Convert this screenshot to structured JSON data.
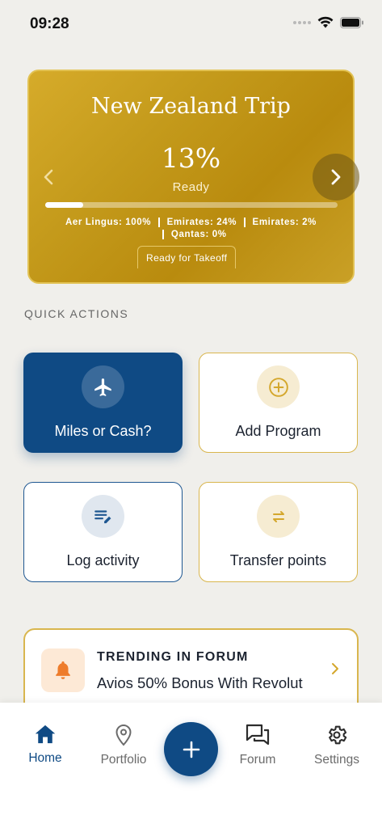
{
  "status_bar": {
    "time": "09:28"
  },
  "trip_card": {
    "title": "New Zealand Trip",
    "percent": "13%",
    "status": "Ready",
    "progress": 0.13,
    "programs": [
      "Aer Lingus: 100%",
      "Emirates: 24%",
      "Emirates: 2%",
      "Qantas: 0%"
    ],
    "badge": "Ready for Takeoff"
  },
  "quick_actions": {
    "heading": "QUICK ACTIONS",
    "miles_or_cash": "Miles or Cash?",
    "add_program": "Add Program",
    "log_activity": "Log activity",
    "transfer_points": "Transfer points"
  },
  "forum": {
    "heading": "TRENDING IN FORUM",
    "text": "Avios 50% Bonus With Revolut"
  },
  "nav": {
    "home": "Home",
    "portfolio": "Portfolio",
    "forum": "Forum",
    "settings": "Settings"
  },
  "colors": {
    "primary": "#0f4a84",
    "gold": "#d9b64e",
    "background": "#f0efeb",
    "bell": "#ee7c2b"
  }
}
